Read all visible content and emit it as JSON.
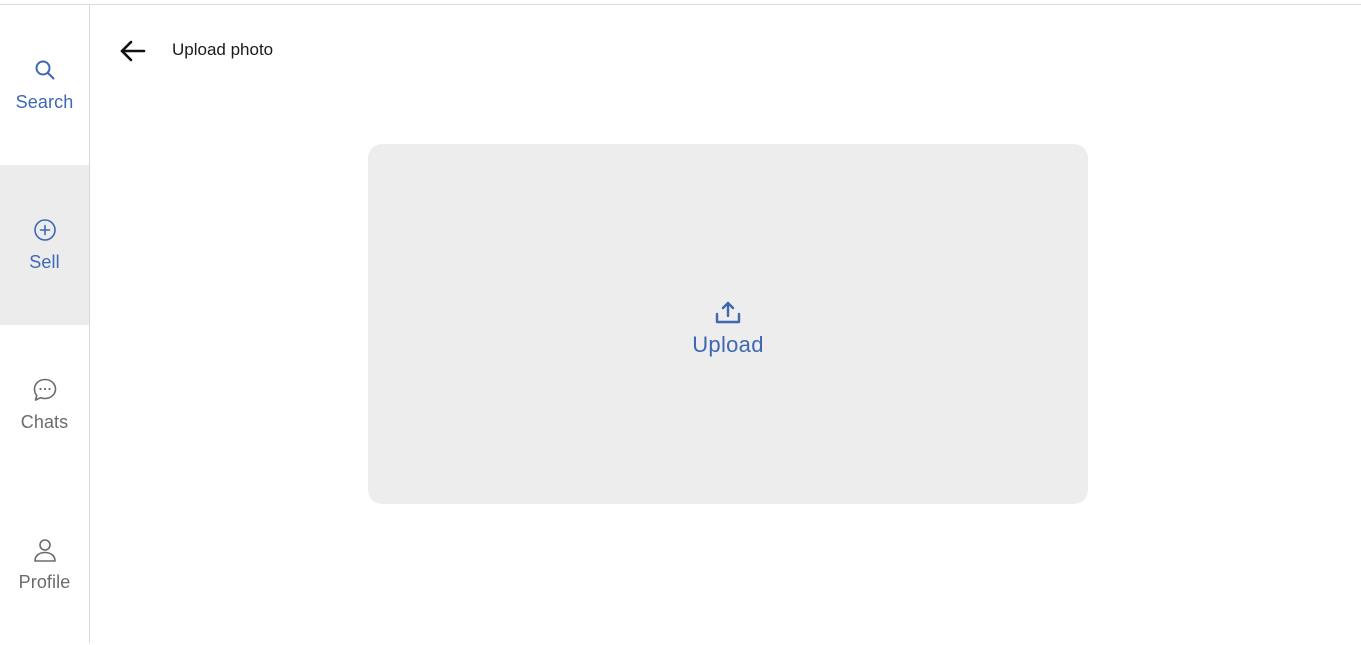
{
  "colors": {
    "accent": "#3f67b4",
    "muted": "#6b6b6b",
    "active_bg": "#ececec",
    "upload_bg": "#ededed"
  },
  "sidebar": {
    "items": [
      {
        "label": "Search",
        "icon": "search-icon",
        "active": false,
        "color": "#3f67b4"
      },
      {
        "label": "Sell",
        "icon": "plus-circle-icon",
        "active": true,
        "color": "#3f67b4"
      },
      {
        "label": "Chats",
        "icon": "chat-bubble-icon",
        "active": false,
        "color": "#6b6b6b"
      },
      {
        "label": "Profile",
        "icon": "person-icon",
        "active": false,
        "color": "#6b6b6b"
      }
    ]
  },
  "header": {
    "back_icon": "arrow-left-icon",
    "title": "Upload photo"
  },
  "upload": {
    "icon": "upload-icon",
    "label": "Upload"
  }
}
